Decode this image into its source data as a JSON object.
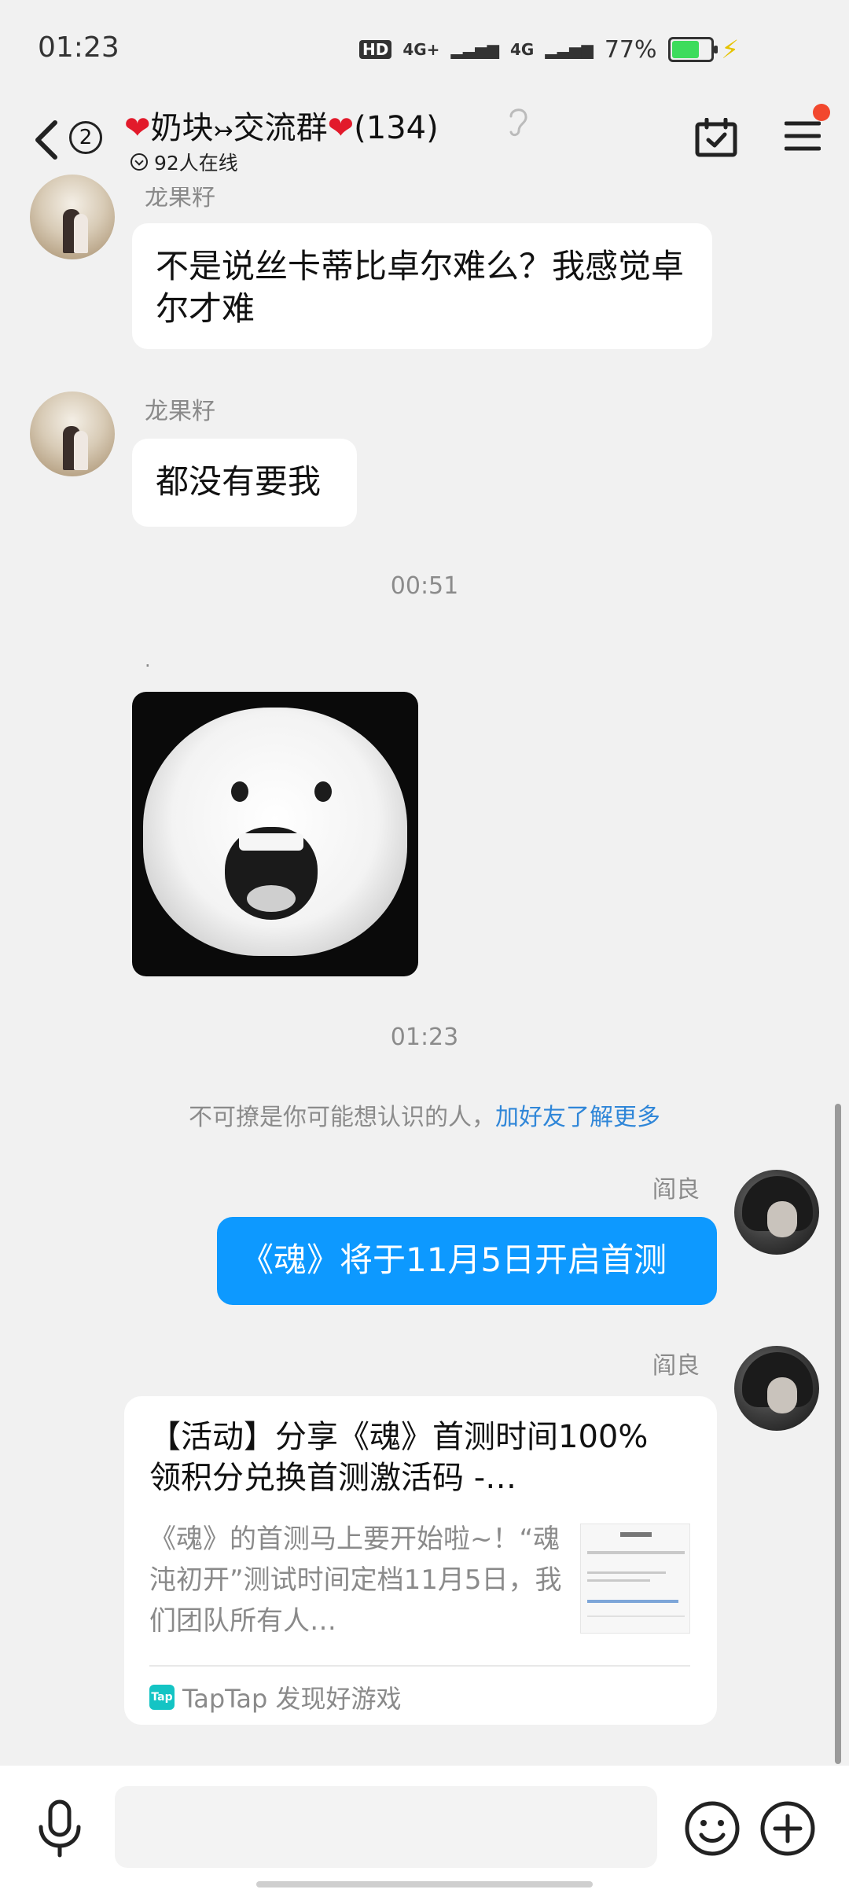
{
  "status_bar": {
    "time": "01:23",
    "hd_label": "HD",
    "net1": "4G+",
    "net2": "4G",
    "battery_percent": "77%",
    "battery_level": 0.77
  },
  "header": {
    "unread_count": "2",
    "title_heart": "❤",
    "title_name": "奶块",
    "title_arrow": "↣",
    "title_group": "交流群",
    "member_count": "(134)",
    "online_text": "92人在线"
  },
  "messages": {
    "msg1": {
      "sender": "龙果籽",
      "text": "不是说丝卡蒂比卓尔难么？我感觉卓尔才难"
    },
    "msg2": {
      "sender": "龙果籽",
      "text": "都没有要我"
    },
    "time1": "00:51",
    "sticker_sender": ".",
    "time2": "01:23",
    "system_notice": "不可撩是你可能想认识的人，",
    "system_link": "加好友了解更多",
    "msg3": {
      "sender": "阎良",
      "text": "《魂》将于11月5日开启首测"
    },
    "msg4": {
      "sender": "阎良",
      "card_title": "【活动】分享《魂》首测时间100%领积分兑换首测激活码 -…",
      "card_desc": "《魂》的首测马上要开始啦~！“魂沌初开”测试时间定档11月5日，我们团队所有人…",
      "card_source_icon": "Tap",
      "card_source": "TapTap 发现好游戏"
    }
  },
  "input": {
    "placeholder": "",
    "value": ""
  },
  "colors": {
    "accent_blue": "#0d99ff",
    "link_blue": "#2f86d8",
    "heart_red": "#e21a2b",
    "badge_red": "#f2482e",
    "background": "#f1f1f1"
  },
  "icons": [
    "back-icon",
    "ear-icon",
    "calendar-check-icon",
    "menu-icon",
    "mic-icon",
    "emoji-icon",
    "plus-icon"
  ]
}
